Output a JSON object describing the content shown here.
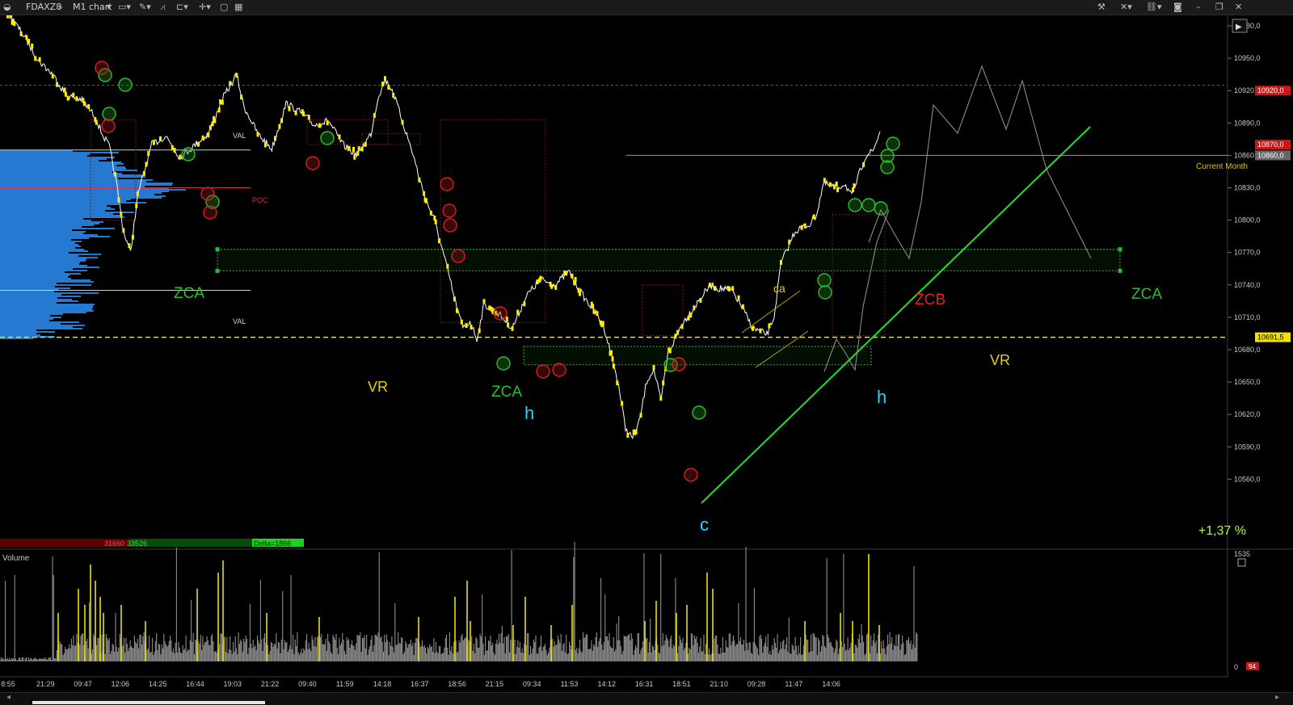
{
  "toolbar": {
    "symbol": "FDAXZ8",
    "chart_label": "M1 chart",
    "icons_left": [
      "search-icon",
      "monitor-icon",
      "pencil-icon",
      "indicator-icon",
      "layout-icon",
      "crosshair-icon",
      "window-icon",
      "palette-icon"
    ],
    "icons_right": [
      "tools-icon",
      "cross-icon",
      "link-icon",
      "camera-icon",
      "minimize-icon",
      "restore-icon",
      "close-icon"
    ]
  },
  "chart_data": {
    "type": "line",
    "series": [],
    "price_axis": {
      "ticks": [
        "10980,0",
        "10950,0",
        "10920,0",
        "10890,0",
        "10860,0",
        "10830,0",
        "10800,0",
        "10770,0",
        "10740,0",
        "10710,0",
        "10680,0",
        "10650,0",
        "10620,0",
        "10590,0",
        "10560,0"
      ],
      "ylim": [
        10550,
        11000
      ]
    },
    "time_axis": {
      "ticks": [
        "8:55",
        "21:29",
        "09:47",
        "12:06",
        "14:25",
        "16:44",
        "19:03",
        "21:22",
        "09:40",
        "11:59",
        "14:18",
        "16:37",
        "18:56",
        "21:15",
        "09:34",
        "11:53",
        "14:12",
        "16:31",
        "18:51",
        "21:10",
        "09:28",
        "11:47",
        "14:06"
      ]
    },
    "price_path": [
      [
        0,
        10998
      ],
      [
        3,
        10970
      ],
      [
        5,
        10948
      ],
      [
        7,
        10935
      ],
      [
        9,
        10915
      ],
      [
        11,
        10912
      ],
      [
        13,
        10896
      ],
      [
        14,
        10880
      ],
      [
        15,
        10868
      ],
      [
        16,
        10835
      ],
      [
        17,
        10790
      ],
      [
        18,
        10770
      ],
      [
        19,
        10822
      ],
      [
        21,
        10870
      ],
      [
        23,
        10878
      ],
      [
        25,
        10858
      ],
      [
        27,
        10869
      ],
      [
        29,
        10880
      ],
      [
        31,
        10912
      ],
      [
        33,
        10935
      ],
      [
        34,
        10906
      ],
      [
        36,
        10880
      ],
      [
        38,
        10866
      ],
      [
        40,
        10908
      ],
      [
        42,
        10900
      ],
      [
        44,
        10888
      ],
      [
        46,
        10892
      ],
      [
        48,
        10870
      ],
      [
        50,
        10860
      ],
      [
        52,
        10880
      ],
      [
        53,
        10914
      ],
      [
        54,
        10930
      ],
      [
        55,
        10921
      ],
      [
        56,
        10901
      ],
      [
        58,
        10860
      ],
      [
        59,
        10835
      ],
      [
        60,
        10815
      ],
      [
        61,
        10800
      ],
      [
        62,
        10775
      ],
      [
        63,
        10750
      ],
      [
        64,
        10722
      ],
      [
        65,
        10700
      ],
      [
        66,
        10706
      ],
      [
        67,
        10690
      ],
      [
        68,
        10722
      ],
      [
        70,
        10714
      ],
      [
        72,
        10700
      ],
      [
        74,
        10730
      ],
      [
        76,
        10745
      ],
      [
        78,
        10740
      ],
      [
        80,
        10752
      ],
      [
        82,
        10730
      ],
      [
        84,
        10712
      ],
      [
        85,
        10700
      ],
      [
        86,
        10675
      ],
      [
        87,
        10648
      ],
      [
        88,
        10607
      ],
      [
        89,
        10598
      ],
      [
        90,
        10614
      ],
      [
        91,
        10651
      ],
      [
        92,
        10662
      ],
      [
        93,
        10632
      ],
      [
        94,
        10676
      ],
      [
        96,
        10704
      ],
      [
        98,
        10722
      ],
      [
        100,
        10740
      ],
      [
        101,
        10737
      ],
      [
        103,
        10735
      ],
      [
        104,
        10725
      ],
      [
        106,
        10700
      ],
      [
        108,
        10694
      ],
      [
        109,
        10710
      ],
      [
        110,
        10760
      ],
      [
        111,
        10775
      ],
      [
        112,
        10790
      ],
      [
        114,
        10796
      ],
      [
        115,
        10805
      ],
      [
        116,
        10834
      ],
      [
        118,
        10830
      ],
      [
        119,
        10834
      ],
      [
        120,
        10822
      ],
      [
        121,
        10842
      ],
      [
        122,
        10860
      ],
      [
        123,
        10864
      ],
      [
        124,
        10882
      ]
    ],
    "forecast_path": [
      [
        1075,
        300
      ],
      [
        1090,
        260
      ],
      [
        1110,
        295
      ],
      [
        1125,
        320
      ],
      [
        1140,
        250
      ],
      [
        1155,
        130
      ],
      [
        1185,
        165
      ],
      [
        1215,
        82
      ],
      [
        1245,
        160
      ],
      [
        1265,
        100
      ],
      [
        1295,
        210
      ],
      [
        1350,
        320
      ]
    ],
    "forecast_path2": [
      [
        1020,
        460
      ],
      [
        1035,
        420
      ],
      [
        1048,
        440
      ],
      [
        1058,
        458
      ],
      [
        1068,
        380
      ],
      [
        1085,
        300
      ],
      [
        1100,
        260
      ]
    ],
    "levels": {
      "red_resistance": 10925,
      "current_month": 10860,
      "current_price": 10691.5,
      "current_price_label": "10691,5",
      "current_month_price_label": "10860,0",
      "marker_price_label": "10870,0",
      "red_level_label": "10920,0",
      "val_upper": 10865,
      "poc": 10830,
      "val_lower": 10735
    },
    "zca_zones": [
      {
        "top": 10773,
        "bottom": 10753
      },
      {
        "top": 10683,
        "bottom": 10666
      }
    ],
    "annotations": {
      "zca_left": "ZCA",
      "zca_right": "ZCA",
      "zca_lower": "ZCA",
      "zcb": "ZCB",
      "ca": "ca",
      "vr_left": "VR",
      "vr_right": "VR",
      "h_left": "h",
      "h_right": "h",
      "c_label": "c",
      "current_month": "Current Month",
      "val_top": "VAL",
      "val_bottom": "VAL",
      "poc": "POC",
      "percent": "+1,37 %"
    },
    "delta_bar": {
      "sell": "31660",
      "buy": "33526",
      "delta": "Delta=1866"
    },
    "volume_panel": {
      "title": "Volume",
      "max_tick": "1535",
      "min_tick": "0",
      "last_value": "94"
    },
    "colors": {
      "background": "#000000",
      "price_line": "#ffffff",
      "yellow_markers": "#ffee00",
      "zca_green": "#22c02a",
      "trend_line": "#22e02a",
      "red_level": "#e02020",
      "current_price_line": "#f2e200",
      "profile_blue": "#2a86e8",
      "volume_grey": "#8c8c8c",
      "volume_yellow": "#e8e000",
      "label_cyan": "#2ad7ff",
      "label_yellow": "#e8d000",
      "percent_green": "#b0ff30"
    }
  }
}
